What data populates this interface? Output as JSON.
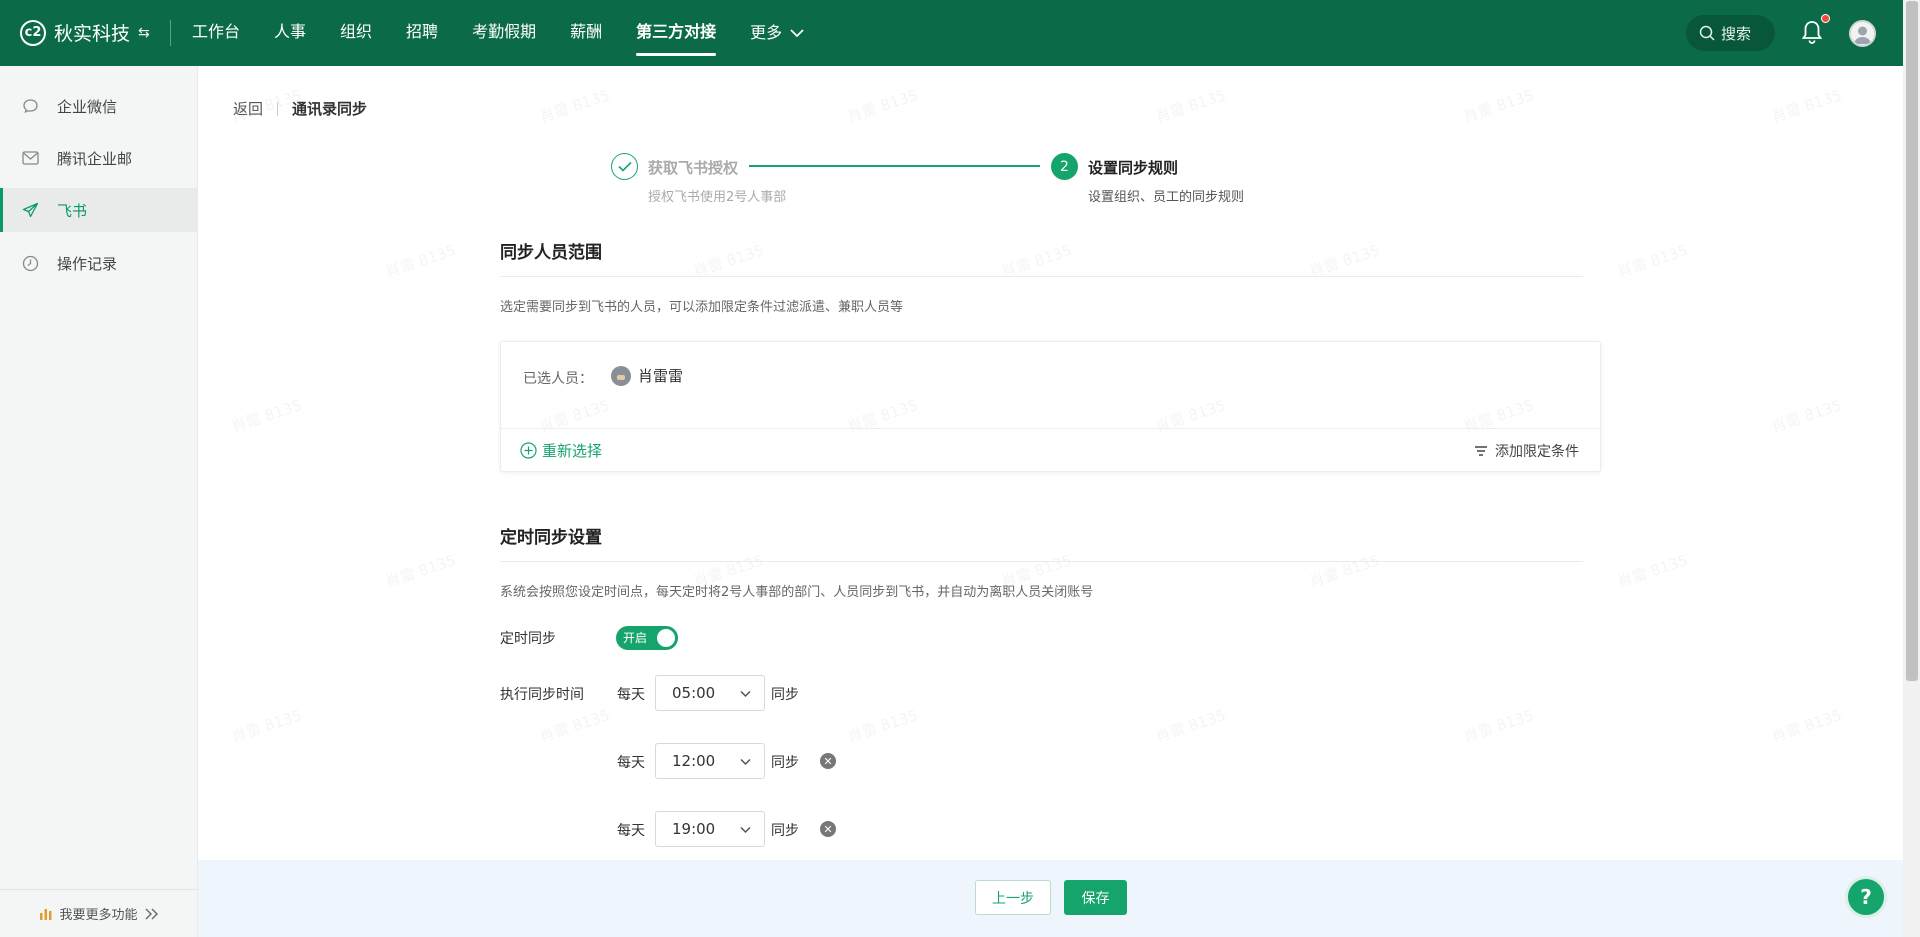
{
  "app": {
    "logo_mark": "c2",
    "brand": "秋实科技",
    "switch_glyph": "⇆"
  },
  "nav": {
    "items": [
      {
        "label": "工作台"
      },
      {
        "label": "人事"
      },
      {
        "label": "组织"
      },
      {
        "label": "招聘"
      },
      {
        "label": "考勤假期"
      },
      {
        "label": "薪酬"
      },
      {
        "label": "第三方对接",
        "active": true
      }
    ],
    "more_label": "更多",
    "search_label": "搜索"
  },
  "sidebar": {
    "items": [
      {
        "label": "企业微信",
        "icon": "chat-bubble-icon"
      },
      {
        "label": "腾讯企业邮",
        "icon": "mail-icon"
      },
      {
        "label": "飞书",
        "icon": "send-icon",
        "active": true
      },
      {
        "label": "操作记录",
        "icon": "clock-icon"
      }
    ],
    "footer_label": "我要更多功能"
  },
  "breadcrumb": {
    "back": "返回",
    "current": "通讯录同步"
  },
  "steps": [
    {
      "title": "获取飞书授权",
      "desc": "授权飞书使用2号人事部",
      "state": "done"
    },
    {
      "number": "2",
      "title": "设置同步规则",
      "desc": "设置组织、员工的同步规则",
      "state": "active"
    }
  ],
  "scope": {
    "title": "同步人员范围",
    "desc": "选定需要同步到飞书的人员，可以添加限定条件过滤派遣、兼职人员等",
    "selected_label": "已选人员：",
    "selected_person": "肖雷雷",
    "reselect_label": "重新选择",
    "add_filter_label": "添加限定条件"
  },
  "schedule": {
    "title": "定时同步设置",
    "desc": "系统会按照您设定时间点，每天定时将2号人事部的部门、人员同步到飞书，并自动为离职人员关闭账号",
    "toggle_label": "定时同步",
    "toggle_text": "开启",
    "toggle_on": true,
    "time_label": "执行同步时间",
    "times": [
      {
        "prefix": "每天",
        "value": "05:00",
        "suffix": "同步",
        "removable": false
      },
      {
        "prefix": "每天",
        "value": "12:00",
        "suffix": "同步",
        "removable": true
      },
      {
        "prefix": "每天",
        "value": "19:00",
        "suffix": "同步",
        "removable": true
      }
    ]
  },
  "footer": {
    "prev_label": "上一步",
    "save_label": "保存"
  },
  "help_glyph": "?",
  "watermark": "肖雷 8135",
  "colors": {
    "topbar": "#0b6b48",
    "accent": "#16a46d",
    "notification_dot": "#f04a3a"
  }
}
